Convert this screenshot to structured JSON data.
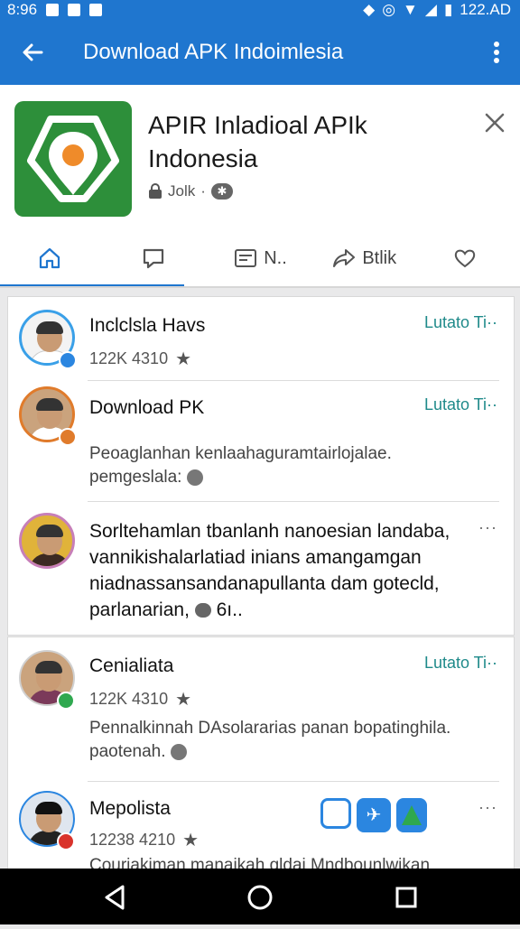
{
  "status": {
    "left_time": "8:96",
    "right_time": "122.AD"
  },
  "appbar": {
    "title": "Download APK Indoimlesia"
  },
  "app": {
    "name": "APIR Inladioal APIk Indonesia",
    "meta_text": "Jolk",
    "meta_sep": "·"
  },
  "tabs": [
    {
      "label": ""
    },
    {
      "label": ""
    },
    {
      "label": "N.."
    },
    {
      "label": "Btlik"
    },
    {
      "label": ""
    }
  ],
  "posts": [
    {
      "name": "Inclclsla Havs",
      "stats": "122K  4310",
      "link": "Lutato Ti··"
    },
    {
      "name": "Download  PK",
      "link": "Lutato Ti··",
      "desc1": "Peoaglanhan kenlaahaguramtairlojalae.",
      "desc2": "pemgeslala:"
    },
    {
      "desc1": "Sorltehamlan tbanlanh nanoesian  landaba,",
      "desc2": "vannikishalarlatiad inians amangamgan",
      "desc3": "niadnassansandanapullanta dam  gotecld,",
      "desc4": "parlanarian,",
      "desc_tail": "6ı..",
      "more": "···"
    },
    {
      "name": "Cenialiata",
      "stats": "122K  4310",
      "link": "Lutato Ti··",
      "desc1": "Pennalkinnah DAsolararias panan bopatinghila.",
      "desc2": "paotenah."
    },
    {
      "name": "Mepolista",
      "stats": "12238  4210",
      "desc1": "Couriakiman manaikah gldai Mndbounlwikan",
      "more": "···"
    }
  ]
}
